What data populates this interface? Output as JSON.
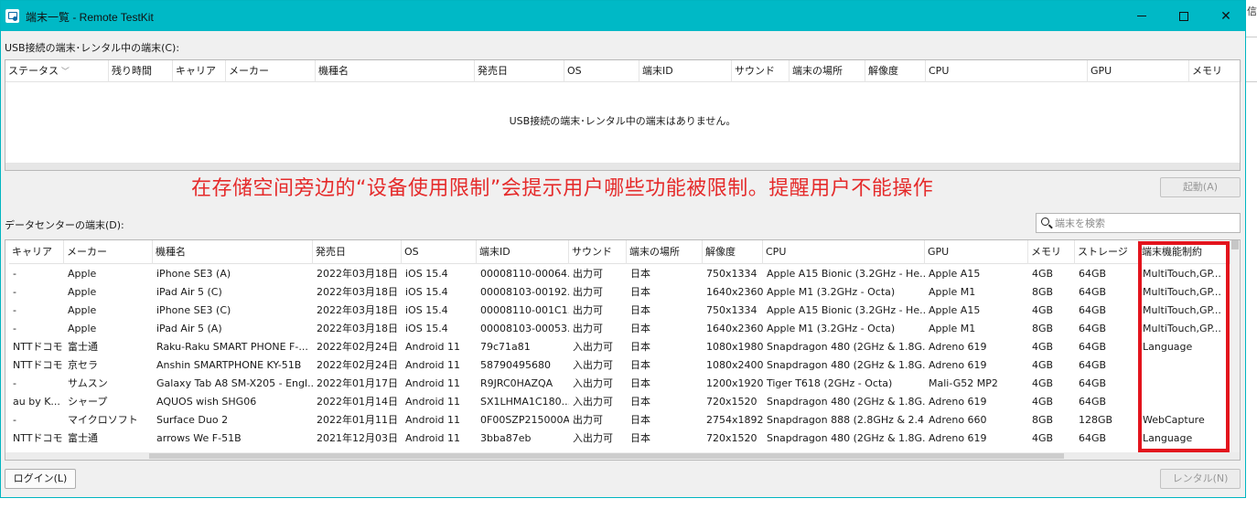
{
  "window": {
    "title": "端末一覧 - Remote TestKit",
    "bg_right_glyph": "信"
  },
  "usb": {
    "label": "USB接続の端末･レンタル中の端末(C):",
    "columns": [
      "ステータス",
      "残り時間",
      "キャリア",
      "メーカー",
      "機種名",
      "発売日",
      "OS",
      "端末ID",
      "サウンド",
      "端末の場所",
      "解像度",
      "CPU",
      "GPU",
      "メモリ"
    ],
    "empty_message": "USB接続の端末･レンタル中の端末はありません。"
  },
  "annotation": "在存储空间旁边的“设备使用限制”会提示用户哪些功能被限制。提醒用户不能操作",
  "start_button": "起動(A)",
  "datacenter": {
    "label": "データセンターの端末(D):",
    "search_placeholder": "端末を検索",
    "columns": [
      "キャリア",
      "メーカー",
      "機種名",
      "発売日",
      "OS",
      "端末ID",
      "サウンド",
      "端末の場所",
      "解像度",
      "CPU",
      "GPU",
      "メモリ",
      "ストレージ",
      "端末機能制約"
    ],
    "rows": [
      [
        "-",
        "Apple",
        "iPhone SE3 (A)",
        "2022年03月18日",
        "iOS 15.4",
        "00008110-00064...",
        "出力可",
        "日本",
        "750x1334",
        "Apple A15 Bionic (3.2GHz - He...",
        "Apple A15",
        "4GB",
        "64GB",
        "MultiTouch,GP..."
      ],
      [
        "-",
        "Apple",
        "iPad Air 5 (C)",
        "2022年03月18日",
        "iOS 15.4",
        "00008103-00192...",
        "出力可",
        "日本",
        "1640x2360",
        "Apple M1 (3.2GHz - Octa)",
        "Apple M1",
        "8GB",
        "64GB",
        "MultiTouch,GP..."
      ],
      [
        "-",
        "Apple",
        "iPhone SE3 (C)",
        "2022年03月18日",
        "iOS 15.4",
        "00008110-001C1...",
        "出力可",
        "日本",
        "750x1334",
        "Apple A15 Bionic (3.2GHz - He...",
        "Apple A15",
        "4GB",
        "64GB",
        "MultiTouch,GP..."
      ],
      [
        "-",
        "Apple",
        "iPad Air 5 (A)",
        "2022年03月18日",
        "iOS 15.4",
        "00008103-00053...",
        "出力可",
        "日本",
        "1640x2360",
        "Apple M1 (3.2GHz - Octa)",
        "Apple M1",
        "8GB",
        "64GB",
        "MultiTouch,GP..."
      ],
      [
        "NTTドコモ",
        "富士通",
        "Raku-Raku SMART PHONE F-...",
        "2022年02月24日",
        "Android 11",
        "79c71a81",
        "入出力可",
        "日本",
        "1080x1980",
        "Snapdragon 480 (2GHz & 1.8G...",
        "Adreno 619",
        "4GB",
        "64GB",
        "Language"
      ],
      [
        "NTTドコモ",
        "京セラ",
        "Anshin SMARTPHONE KY-51B",
        "2022年02月24日",
        "Android 11",
        "58790495680",
        "入出力可",
        "日本",
        "1080x2400",
        "Snapdragon 480 (2GHz & 1.8G...",
        "Adreno 619",
        "4GB",
        "64GB",
        ""
      ],
      [
        "-",
        "サムスン",
        "Galaxy Tab A8 SM-X205 - Engl...",
        "2022年01月17日",
        "Android 11",
        "R9JRC0HAZQA",
        "入出力可",
        "日本",
        "1200x1920",
        "Tiger T618 (2GHz - Octa)",
        "Mali-G52 MP2",
        "4GB",
        "64GB",
        ""
      ],
      [
        "au by K...",
        "シャープ",
        "AQUOS wish SHG06",
        "2022年01月14日",
        "Android 11",
        "SX1LHMA1C180...",
        "入出力可",
        "日本",
        "720x1520",
        "Snapdragon 480 (2GHz & 1.8G...",
        "Adreno 619",
        "4GB",
        "64GB",
        ""
      ],
      [
        "-",
        "マイクロソフト",
        "Surface Duo 2",
        "2022年01月11日",
        "Android 11",
        "0F00SZP215000A",
        "出力可",
        "日本",
        "2754x1892",
        "Snapdragon 888 (2.8GHz & 2.4...",
        "Adreno 660",
        "8GB",
        "128GB",
        "WebCapture"
      ],
      [
        "NTTドコモ",
        "富士通",
        "arrows We F-51B",
        "2021年12月03日",
        "Android 11",
        "3bba87eb",
        "入出力可",
        "日本",
        "720x1520",
        "Snapdragon 480 (2GHz & 1.8G...",
        "Adreno 619",
        "4GB",
        "64GB",
        "Language"
      ]
    ]
  },
  "login_button": "ログイン(L)",
  "rent_button": "レンタル(N)"
}
